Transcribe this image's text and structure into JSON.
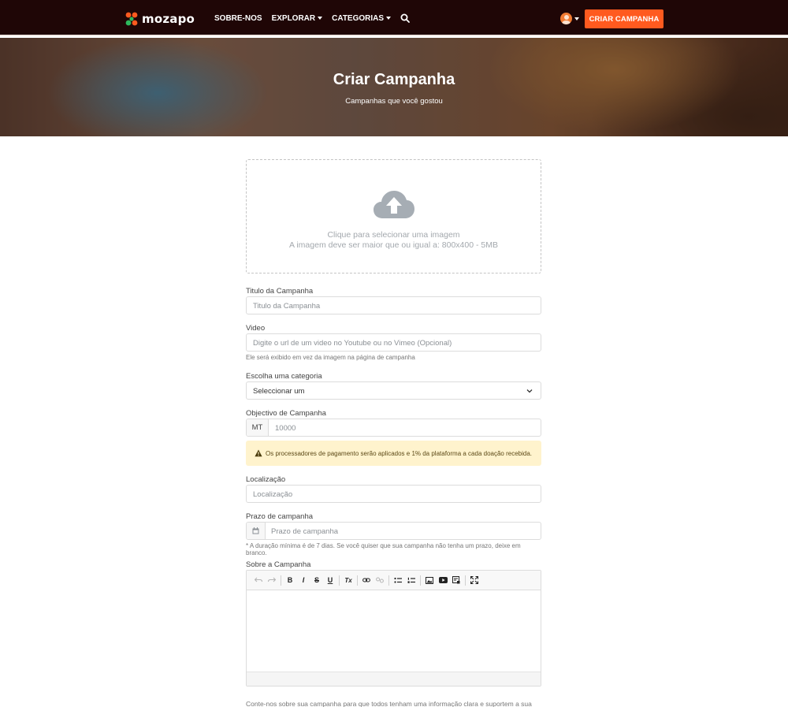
{
  "nav": {
    "brand": "mozapo",
    "links": [
      "SOBRE-NOS",
      "EXPLORAR",
      "CATEGORIAS"
    ],
    "cta": "CRIAR CAMPANHA"
  },
  "hero": {
    "title": "Criar Campanha",
    "subtitle": "Campanhas que você gostou"
  },
  "upload": {
    "line1": "Clique para selecionar uma imagem",
    "line2": "A imagem deve ser maior que ou igual a: 800x400 - 5MB"
  },
  "form": {
    "title_label": "Titulo da Campanha",
    "title_placeholder": "Titulo da Campanha",
    "video_label": "Video",
    "video_placeholder": "Digite o url de um video no Youtube ou no Vimeo (Opcional)",
    "video_help": "Ele será exibido em vez da imagem na página de campanha",
    "category_label": "Escolha uma categoria",
    "category_value": "Seleccionar um",
    "goal_label": "Objectivo de Campanha",
    "goal_currency": "MT",
    "goal_placeholder": "10000",
    "alert": "Os processadores de pagamento serão aplicados e 1% da plataforma a cada doação recebida.",
    "location_label": "Localização",
    "location_placeholder": "Localização",
    "deadline_label": "Prazo de campanha",
    "deadline_placeholder": "Prazo de campanha",
    "deadline_help": "* A duração mínima é de 7 dias. Se você quiser que sua campanha não tenha um prazo, deixe em branco.",
    "about_label": "Sobre a Campanha",
    "about_help": "Conte-nos sobre sua campanha para que todos tenham uma informação clara e suportem a sua causa"
  },
  "toolbar": {
    "bold": "B",
    "italic": "I",
    "strike": "S",
    "underline": "U",
    "clear": "Tx"
  },
  "colors": {
    "navbar": "#1f0606",
    "accent": "#ff5a1f",
    "alert_bg": "#fff3cd"
  }
}
